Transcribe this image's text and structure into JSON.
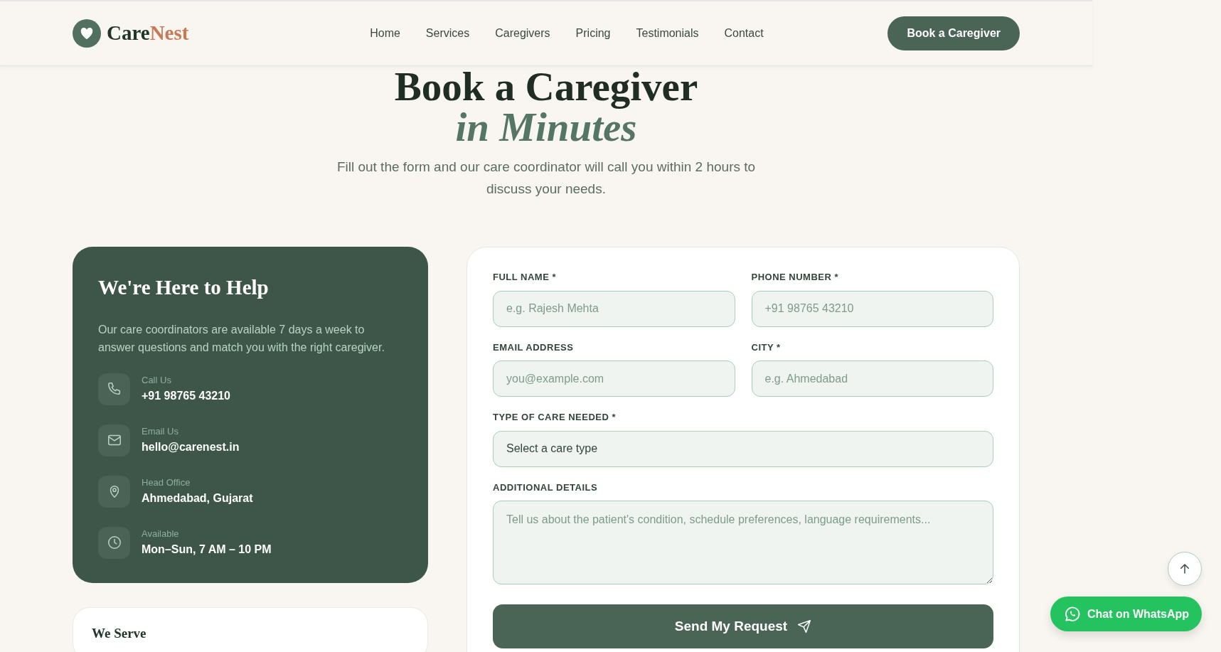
{
  "nav": {
    "logo": {
      "primary": "Care",
      "accent": "Nest"
    },
    "links": [
      "Home",
      "Services",
      "Caregivers",
      "Pricing",
      "Testimonials",
      "Contact"
    ],
    "cta": "Book a Caregiver"
  },
  "hero": {
    "title": "Book a Caregiver",
    "title_accent": "in Minutes",
    "subtitle": "Fill out the form and our care coordinator will call you within 2 hours to discuss your needs."
  },
  "help_card": {
    "title": "We're Here to Help",
    "text": "Our care coordinators are available 7 days a week to answer questions and match you with the right caregiver.",
    "contacts": [
      {
        "kind": "phone",
        "label": "Call Us",
        "value": "+91 98765 43210"
      },
      {
        "kind": "email",
        "label": "Email Us",
        "value": "hello@carenest.in"
      },
      {
        "kind": "location",
        "label": "Head Office",
        "value": "Ahmedabad, Gujarat"
      },
      {
        "kind": "hours",
        "label": "Available",
        "value": "Mon–Sun, 7 AM – 10 PM"
      }
    ]
  },
  "serve_card": {
    "title": "We Serve"
  },
  "form": {
    "fields": [
      {
        "kind": "input",
        "label": "FULL NAME *",
        "placeholder": "e.g. Rajesh Mehta"
      },
      {
        "kind": "input",
        "label": "PHONE NUMBER *",
        "placeholder": "+91 98765 43210"
      },
      {
        "kind": "input",
        "label": "EMAIL ADDRESS",
        "placeholder": "you@example.com"
      },
      {
        "kind": "input",
        "label": "CITY *",
        "placeholder": "e.g. Ahmedabad"
      },
      {
        "kind": "select",
        "label": "TYPE OF CARE NEEDED *",
        "value": "Select a care type"
      },
      {
        "kind": "textarea",
        "label": "ADDITIONAL DETAILS",
        "placeholder": "Tell us about the patient's condition, schedule preferences, language requirements..."
      }
    ],
    "submit": "Send My Request"
  },
  "whatsapp": "Chat on WhatsApp"
}
